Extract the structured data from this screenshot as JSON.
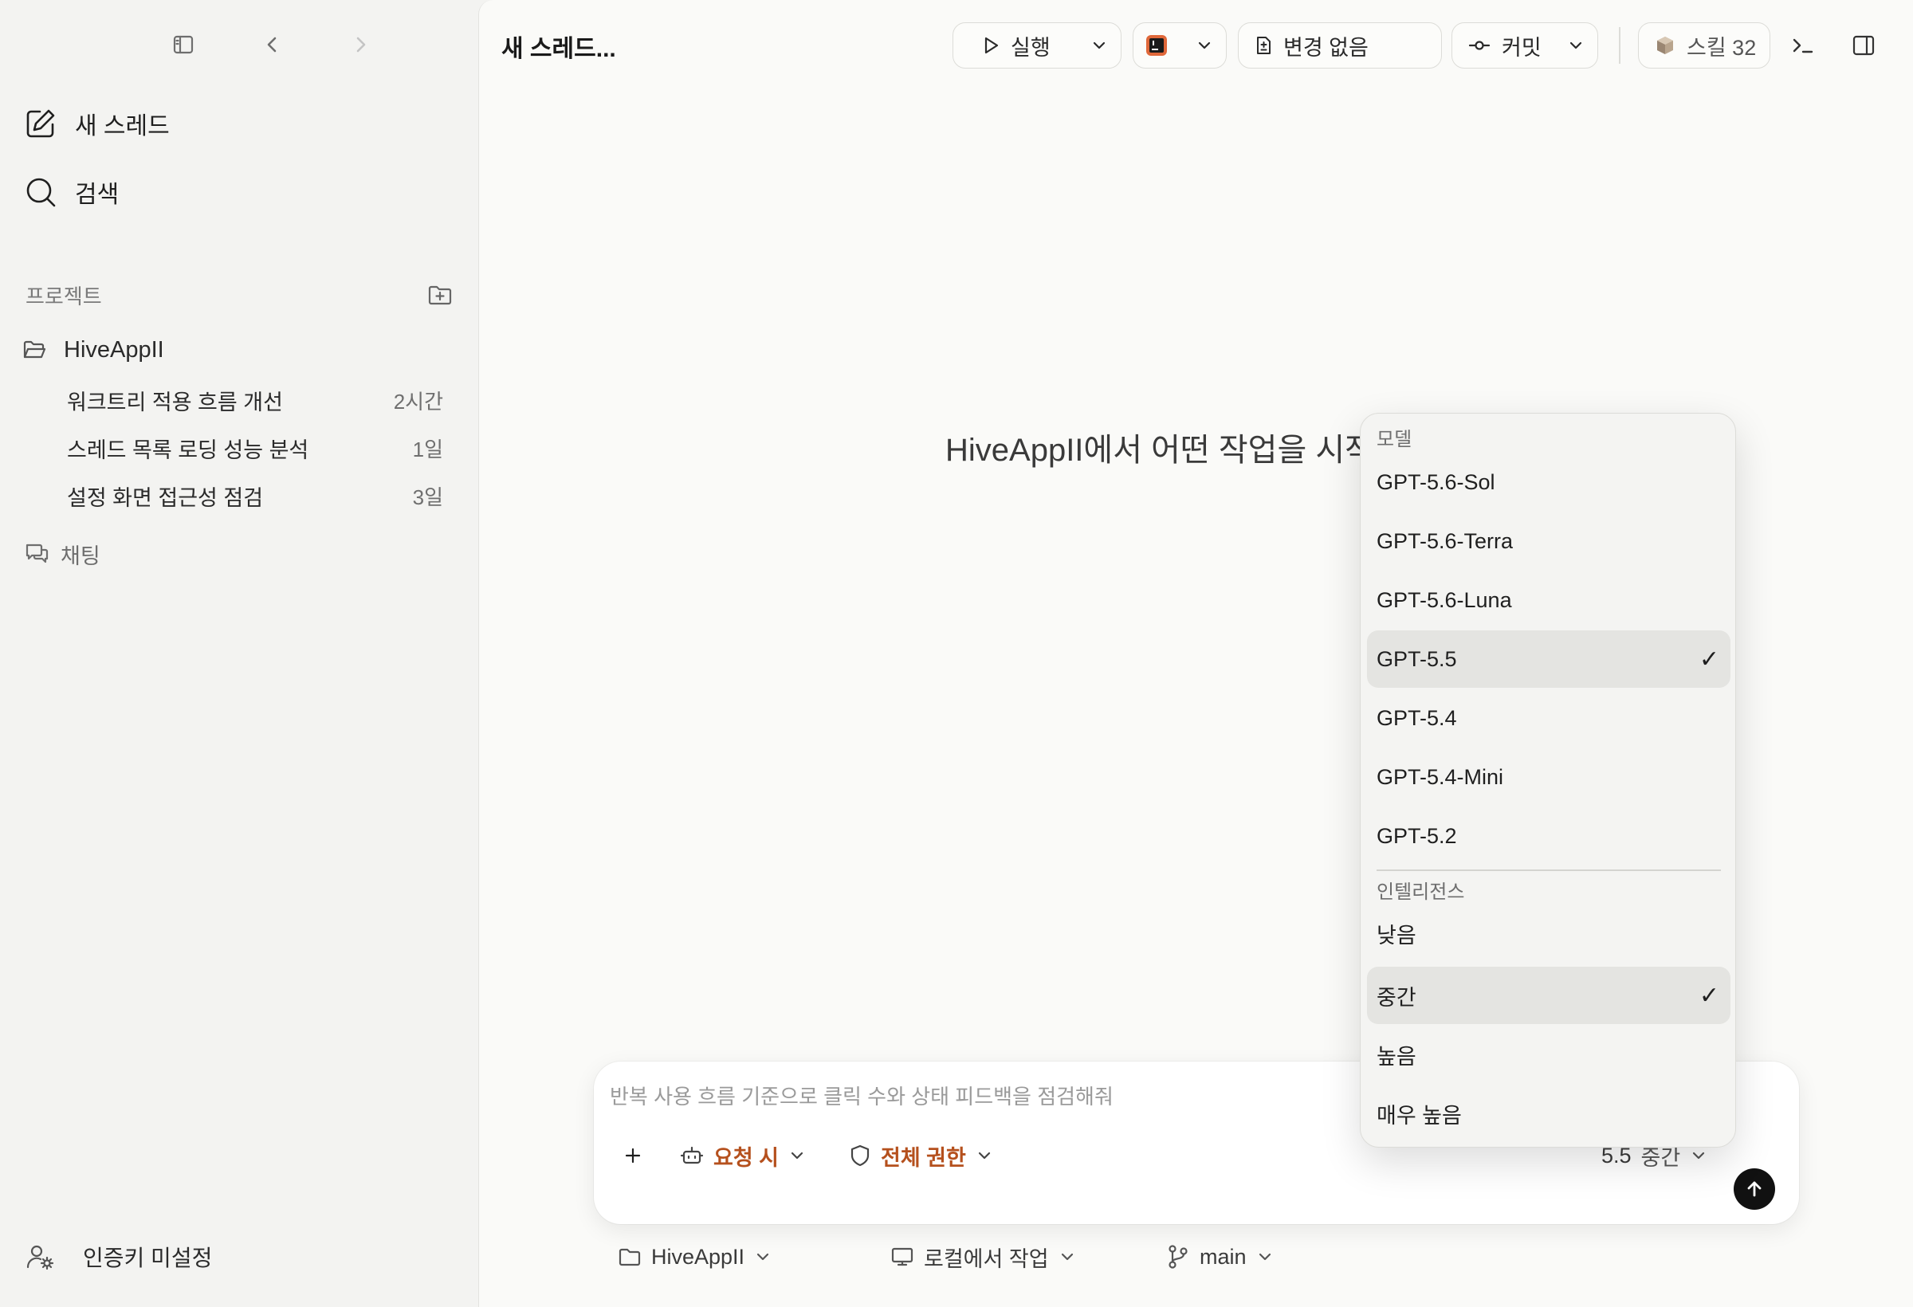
{
  "sidebar": {
    "nav": {
      "new_thread": "새 스레드",
      "search": "검색"
    },
    "projects_header": "프로젝트",
    "project_name": "HiveAppII",
    "threads": [
      {
        "title": "워크트리 적용 흐름 개선",
        "age": "2시간"
      },
      {
        "title": "스레드 목록 로딩 성능 분석",
        "age": "1일"
      },
      {
        "title": "설정 화면 접근성 점검",
        "age": "3일"
      }
    ],
    "chat_label": "채팅",
    "footer_label": "인증키 미설정"
  },
  "header": {
    "title": "새 스레드...",
    "run_label": "실행",
    "changes_label": "변경 없음",
    "commit_label": "커밋",
    "skills_label": "스킬 32"
  },
  "main": {
    "prompt": "HiveAppII에서 어떤 작업을 시작할까요?"
  },
  "composer": {
    "placeholder": "반복 사용 흐름 기준으로 클릭 수와 상태 피드백을 점검해줘",
    "approval_label": "요청 시",
    "permission_label": "전체 권한",
    "model_version": "5.5",
    "intelligence": "중간"
  },
  "context_bar": {
    "project": "HiveAppII",
    "location": "로컬에서 작업",
    "branch": "main"
  },
  "model_menu": {
    "model_header": "모델",
    "models": [
      "GPT-5.6-Sol",
      "GPT-5.6-Terra",
      "GPT-5.6-Luna",
      "GPT-5.5",
      "GPT-5.4",
      "GPT-5.4-Mini",
      "GPT-5.2"
    ],
    "selected_model": "GPT-5.5",
    "intelligence_header": "인텔리전스",
    "levels": [
      "낮음",
      "중간",
      "높음",
      "매우 높음"
    ],
    "selected_level": "중간",
    "check": "✓"
  },
  "colors": {
    "accent": "#b5501d",
    "send_button": "#111111",
    "selected_row": "#e4e4e1"
  }
}
